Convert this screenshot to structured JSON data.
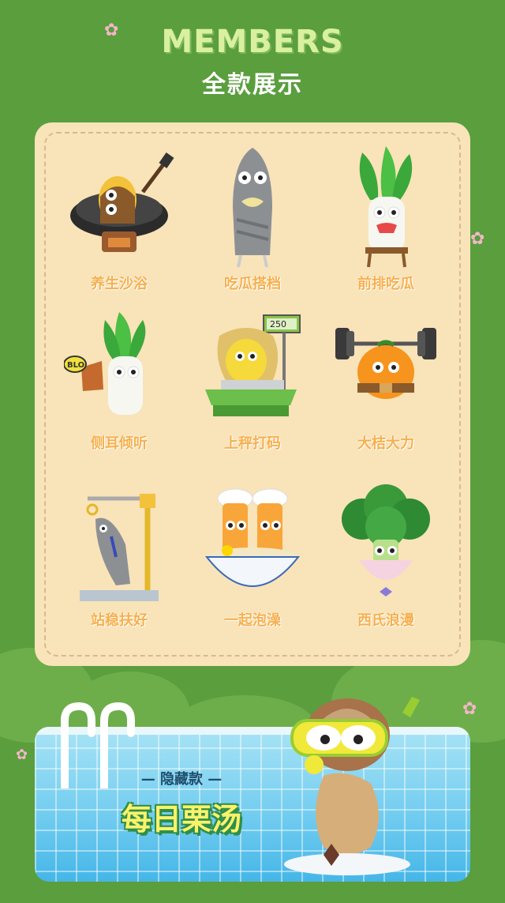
{
  "header": {
    "title_en": "MEMBERS",
    "title_cn": "全款展示"
  },
  "members": [
    {
      "name": "养生沙浴"
    },
    {
      "name": "吃瓜搭档"
    },
    {
      "name": "前排吃瓜"
    },
    {
      "name": "侧耳倾听"
    },
    {
      "name": "上秤打码"
    },
    {
      "name": "大桔大力"
    },
    {
      "name": "站稳扶好"
    },
    {
      "name": "一起泡澡"
    },
    {
      "name": "西氏浪漫"
    }
  ],
  "scale_display": "250",
  "sign_text": "BLO",
  "hidden": {
    "subtitle": "— 隐藏款 —",
    "title": "每日栗汤"
  },
  "colors": {
    "background": "#5a9e3e",
    "card": "#f9e3b9",
    "label": "#f6b04d",
    "title_en": "#d9f0a0",
    "pool": "#6fcbef"
  }
}
